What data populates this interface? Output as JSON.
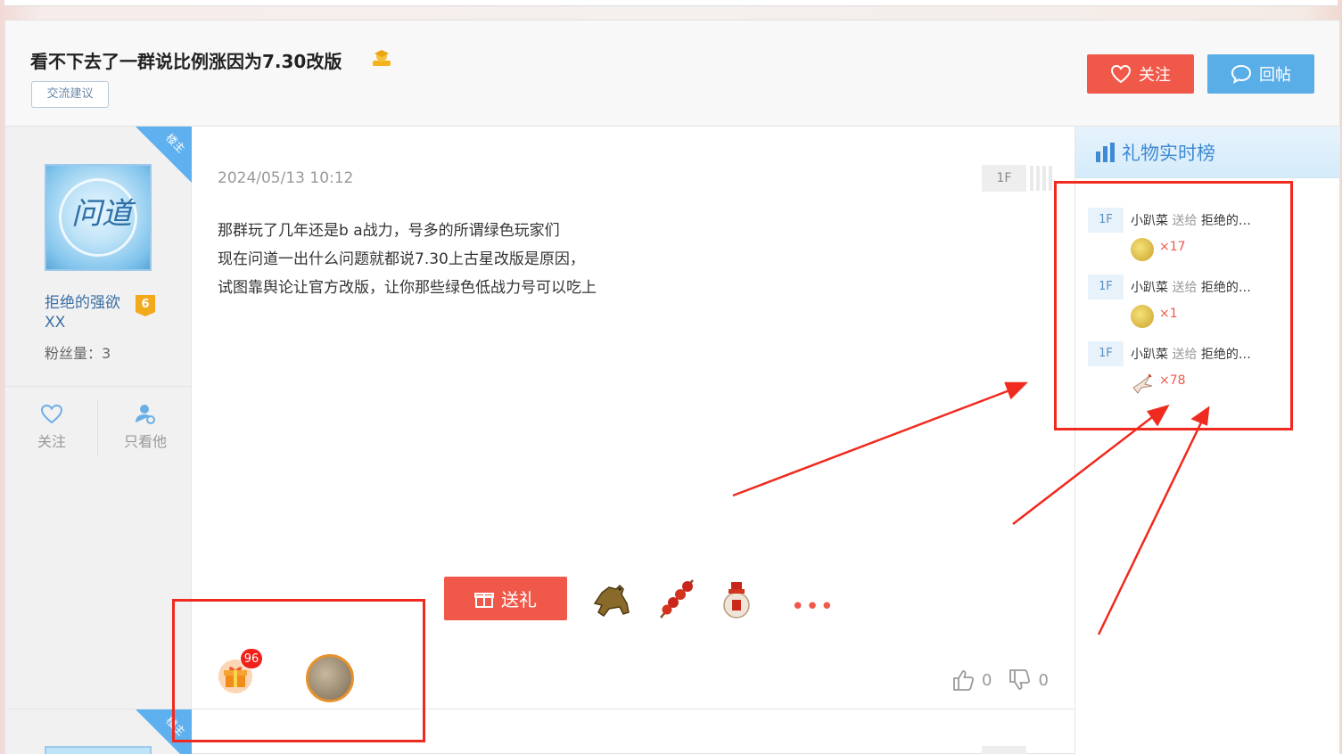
{
  "thread": {
    "title": "看不下去了一群说比例涨因为7.30改版",
    "tag": "交流建议",
    "follow_label": "关注",
    "reply_label": "回帖"
  },
  "author": {
    "corner_label": "楼主",
    "avatar_glyph": "问道",
    "name": "拒绝的强欲XX",
    "level": "6",
    "fans": "粉丝量：3",
    "follow_label": "关注",
    "only_label": "只看他"
  },
  "post": {
    "time": "2024/05/13 10:12",
    "floor": "1F",
    "lines": [
      "那群玩了几年还是b a战力，号多的所谓绿色玩家们",
      "现在问道一出什么问题就都说7.30上古星改版是原因，",
      "试图靠舆论让官方改版，让你那些绿色低战力号可以吃上"
    ],
    "gift_button": "送礼",
    "more": "•••",
    "gift_count": "96",
    "likes": "0",
    "dislikes": "0"
  },
  "sidebar": {
    "title": "礼物实时榜",
    "rows": [
      {
        "floor": "1F",
        "sender": "小趴菜",
        "verb": "送给",
        "receiver": "拒绝的…",
        "count": "×17",
        "gift_color": "#e8c84a"
      },
      {
        "floor": "1F",
        "sender": "小趴菜",
        "verb": "送给",
        "receiver": "拒绝的…",
        "count": "×1",
        "gift_color": "#e8c84a"
      },
      {
        "floor": "1F",
        "sender": "小趴菜",
        "verb": "送给",
        "receiver": "拒绝的…",
        "count": "×78",
        "gift_color": "#f1e3d8"
      }
    ]
  },
  "colors": {
    "accent_red": "#f0594a",
    "accent_blue": "#5aaee8",
    "annotation": "#f02a1e"
  }
}
